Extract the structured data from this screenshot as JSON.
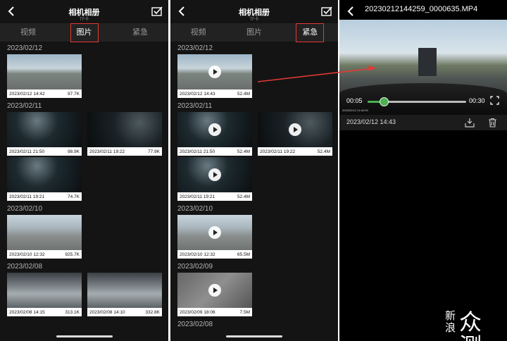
{
  "album": {
    "title": "相机相册",
    "subtitle": "TF卡",
    "tabs": [
      "视频",
      "图片",
      "紧急"
    ]
  },
  "photos_panel": {
    "active_tab": "图片",
    "groups": [
      {
        "date": "2023/02/12",
        "items": [
          {
            "time": "2023/02/12 14:42",
            "size": "97.7K",
            "scene": "day-road"
          }
        ]
      },
      {
        "date": "2023/02/11",
        "items": [
          {
            "time": "2023/02/11 21:50",
            "size": "98.9K",
            "scene": "night"
          },
          {
            "time": "2023/02/11 19:22",
            "size": "77.9K",
            "scene": "night2"
          },
          {
            "time": "2023/02/11 19:21",
            "size": "74.7K",
            "scene": "night"
          }
        ]
      },
      {
        "date": "2023/02/10",
        "items": [
          {
            "time": "2023/02/10 12:32",
            "size": "925.7K",
            "scene": "parking"
          }
        ]
      },
      {
        "date": "2023/02/08",
        "items": [
          {
            "time": "2023/02/08 14:15",
            "size": "313.1K",
            "scene": "garage"
          },
          {
            "time": "2023/02/08 14:10",
            "size": "332.8K",
            "scene": "garage"
          }
        ]
      }
    ]
  },
  "emergency_panel": {
    "active_tab": "紧急",
    "groups": [
      {
        "date": "2023/02/12",
        "items": [
          {
            "time": "2023/02/12 14:43",
            "size": "52.4M",
            "scene": "day-road"
          }
        ]
      },
      {
        "date": "2023/02/11",
        "items": [
          {
            "time": "2023/02/11 21:50",
            "size": "52.4M",
            "scene": "night"
          },
          {
            "time": "2023/02/11 19:22",
            "size": "52.4M",
            "scene": "night2"
          },
          {
            "time": "2023/02/11 19:21",
            "size": "52.4M",
            "scene": "night"
          }
        ]
      },
      {
        "date": "2023/02/10",
        "items": [
          {
            "time": "2023/02/10 12:32",
            "size": "65.5M",
            "scene": "parking"
          }
        ]
      },
      {
        "date": "2023/02/09",
        "items": [
          {
            "time": "2023/02/09 18:06",
            "size": "7.5M",
            "scene": "gray"
          }
        ]
      },
      {
        "date": "2023/02/08",
        "items": []
      }
    ]
  },
  "player": {
    "filename": "20230212144259_0000635.MP4",
    "current_time": "00:05",
    "total_time": "00:30",
    "progress": 0.167,
    "video_stamp": "2023/02/12 14:42:59",
    "date": "2023/02/12 14:43"
  },
  "watermark": {
    "text_a": "新浪",
    "text_b": "众测"
  },
  "colors": {
    "highlight_box": "#e53935",
    "progress": "#4caf50"
  }
}
